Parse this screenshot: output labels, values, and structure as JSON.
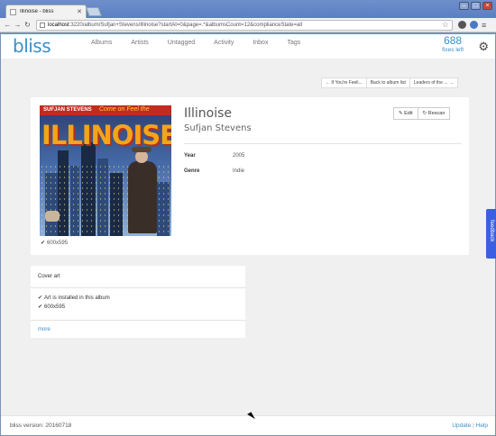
{
  "browser": {
    "tab_title": "Illinoise - bliss",
    "url_host": "localhost",
    "url_rest": ":3220/album/Sufjan+Stevens/Illinoise?startAt=0&page=.*&albumsCount=12&complianceState=all"
  },
  "app": {
    "logo": "bliss",
    "nav": [
      "Albums",
      "Artists",
      "Untagged",
      "Activity",
      "Inbox",
      "Tags"
    ],
    "fixes_count": "688",
    "fixes_label": "fixes left"
  },
  "pager": {
    "prev": "← If You're Feeli...",
    "back": "Back to album list",
    "next": "Leaders of the ... →"
  },
  "album": {
    "title": "Illinoise",
    "artist": "Sufjan Stevens",
    "dims": "600x595",
    "edit_label": "Edit",
    "rescan_label": "Rescan",
    "cover_text": {
      "artist": "SUFJAN STEVENS",
      "come": "Come on Feel the",
      "title": "ILLINOISE"
    },
    "meta": [
      {
        "key": "Year",
        "value": "2005"
      },
      {
        "key": "Genre",
        "value": "Indie"
      }
    ]
  },
  "cover_art_panel": {
    "heading": "Cover art",
    "lines": [
      "Art is installed in this album",
      "600x595"
    ],
    "more": "more"
  },
  "feedback_label": "feedback",
  "footer": {
    "version": "bliss version: 20160718",
    "update": "Update",
    "separator": "|",
    "help": "Help"
  },
  "colors": {
    "brand": "#3a8fc9",
    "feedback": "#3b5fe0",
    "chrome": "#5b7fc4"
  }
}
